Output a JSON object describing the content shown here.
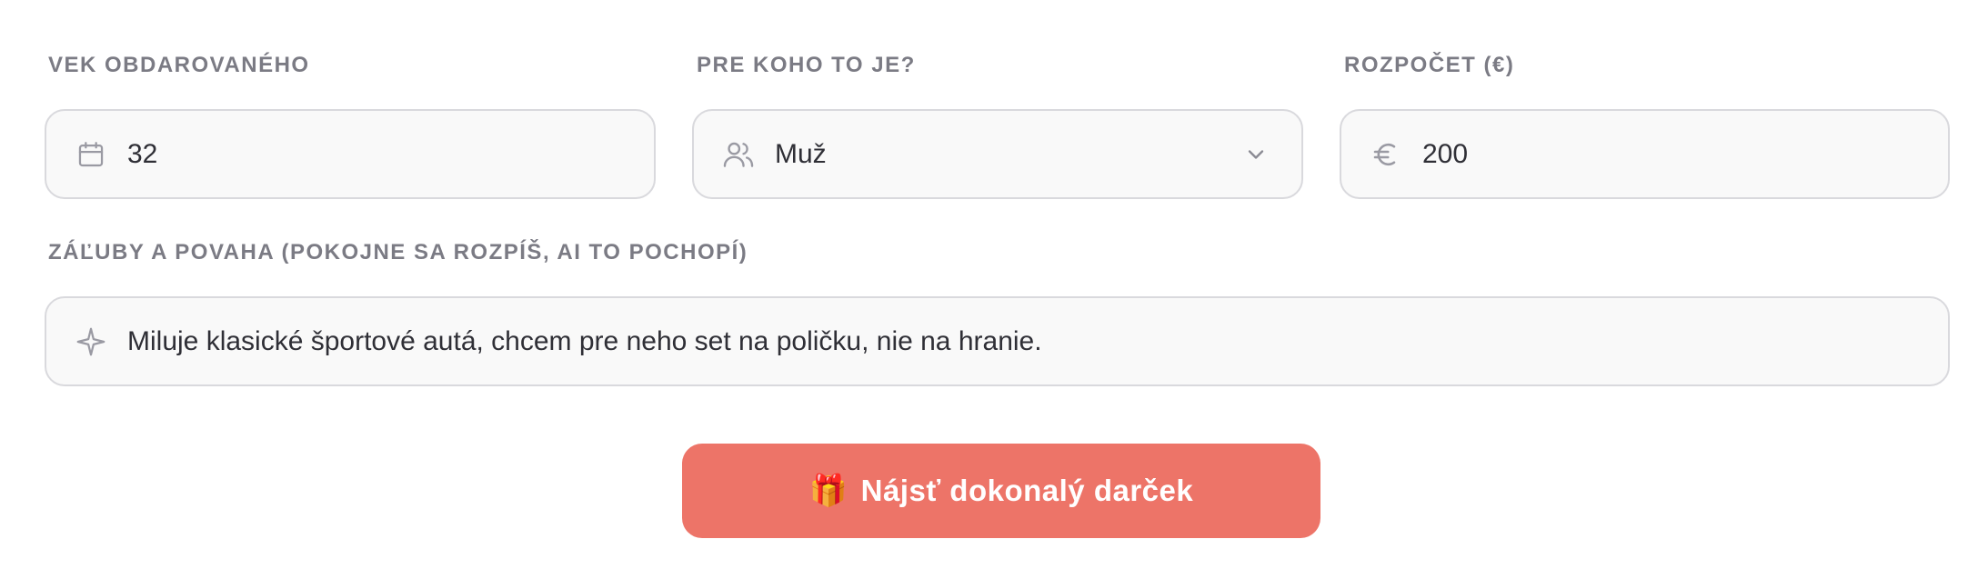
{
  "form": {
    "age": {
      "label": "VEK OBDAROVANÉHO",
      "value": "32",
      "icon": "calendar-icon"
    },
    "recipient": {
      "label": "PRE KOHO TO JE?",
      "selected": "Muž",
      "icon": "users-icon"
    },
    "budget": {
      "label": "ROZPOČET (€)",
      "value": "200",
      "icon": "euro-icon"
    },
    "hobbies": {
      "label": "ZÁĽUBY A POVAHA (POKOJNE SA ROZPÍŠ, AI TO POCHOPÍ)",
      "value": "Miluje klasické športové autá, chcem pre neho set na poličku, nie na hranie.",
      "icon": "sparkle-icon"
    }
  },
  "submit": {
    "emoji": "🎁",
    "label": "Nájsť dokonalý darček"
  },
  "colors": {
    "accent": "#ed7468",
    "field_bg": "#f9f9f9",
    "field_border": "#d9d9dd",
    "label_text": "#7b7b84",
    "value_text": "#2f2f36",
    "icon": "#9a9aa3"
  }
}
